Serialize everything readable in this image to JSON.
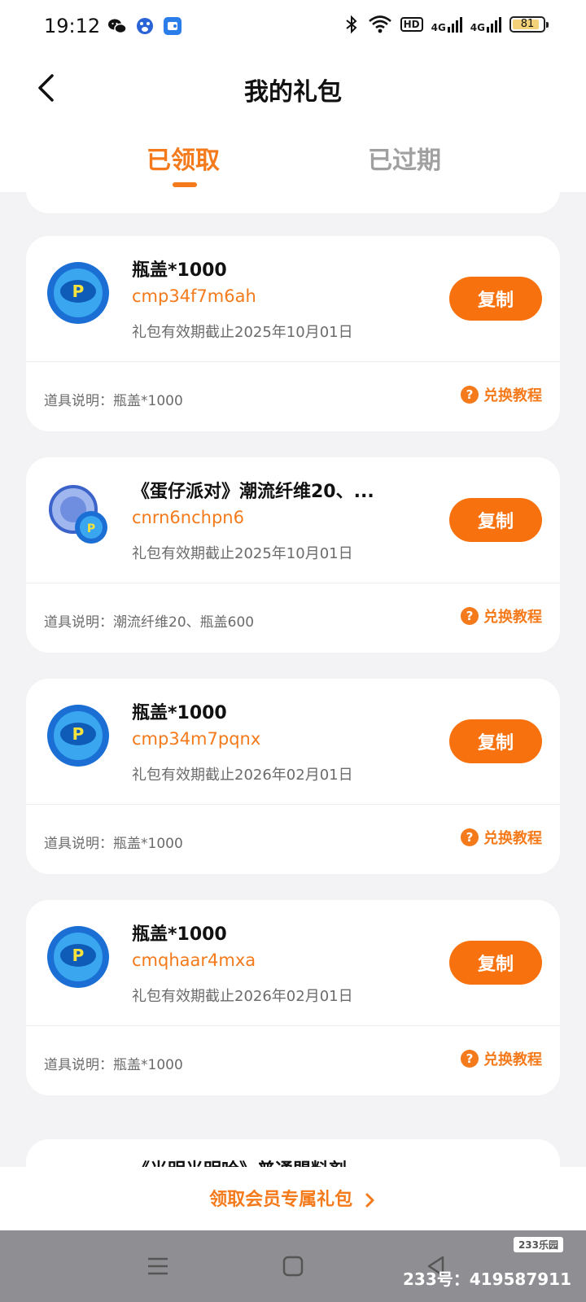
{
  "status_bar": {
    "time": "19:12",
    "hd_label": "HD",
    "net1": "4G",
    "net2": "4G",
    "battery": "81"
  },
  "header": {
    "title": "我的礼包"
  },
  "tabs": [
    {
      "label": "已领取",
      "active": true
    },
    {
      "label": "已过期",
      "active": false
    }
  ],
  "gifts": [
    {
      "name": "瓶盖*1000",
      "code": "cmp34f7m6ah",
      "validity": "礼包有效期截止2025年10月01日",
      "copy_label": "复制",
      "description": "道具说明：瓶盖*1000",
      "tutorial_label": "兑换教程",
      "icon": "bottle-cap-icon"
    },
    {
      "name": "《蛋仔派对》潮流纤维20、...",
      "code": "cnrn6nchpn6",
      "validity": "礼包有效期截止2025年10月01日",
      "copy_label": "复制",
      "description": "道具说明：潮流纤维20、瓶盖600",
      "tutorial_label": "兑换教程",
      "icon": "fiber-bottle-cap-icon"
    },
    {
      "name": "瓶盖*1000",
      "code": "cmp34m7pqnx",
      "validity": "礼包有效期截止2026年02月01日",
      "copy_label": "复制",
      "description": "道具说明：瓶盖*1000",
      "tutorial_label": "兑换教程",
      "icon": "bottle-cap-icon"
    },
    {
      "name": "瓶盖*1000",
      "code": "cmqhaar4mxa",
      "validity": "礼包有效期截止2026年02月01日",
      "copy_label": "复制",
      "description": "道具说明：瓶盖*1000",
      "tutorial_label": "兑换教程",
      "icon": "bottle-cap-icon"
    }
  ],
  "partial_gift_name": "《光明光明哈》普通盟料剂",
  "member_link": "领取会员专属礼包",
  "watermark": {
    "logo": "233乐园",
    "id": "233号：419587911"
  },
  "colors": {
    "accent": "#f47a1b",
    "button": "#f7720f",
    "background": "#f3f3f5"
  }
}
